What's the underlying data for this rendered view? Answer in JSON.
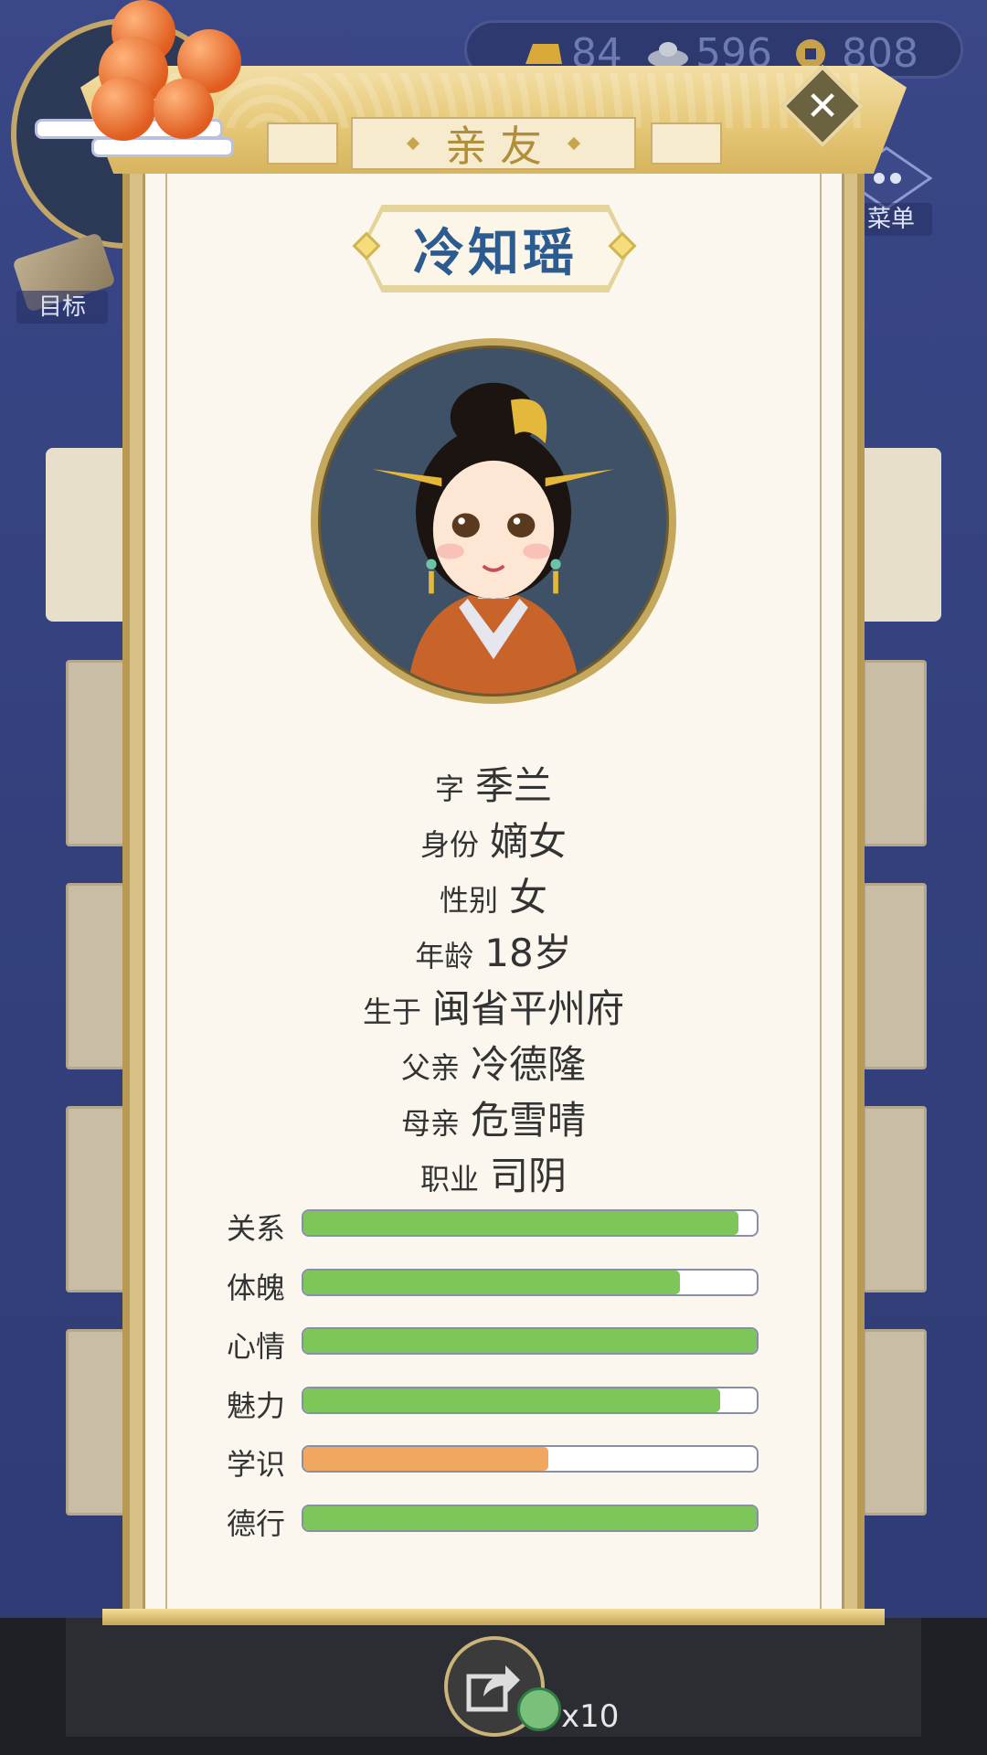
{
  "hud": {
    "goal_label": "目标",
    "menu_label": "菜单"
  },
  "currency": {
    "gold": "84",
    "silver": "596",
    "coins": "808"
  },
  "modal": {
    "title": "亲友",
    "name": "冷知瑶",
    "info": [
      {
        "label": "字",
        "value": "季兰"
      },
      {
        "label": "身份",
        "value": "嫡女"
      },
      {
        "label": "性别",
        "value": "女"
      },
      {
        "label": "年龄",
        "value": "18岁"
      },
      {
        "label": "生于",
        "value": "闽省平州府"
      },
      {
        "label": "父亲",
        "value": "冷德隆"
      },
      {
        "label": "母亲",
        "value": "危雪晴"
      },
      {
        "label": "职业",
        "value": "司阴"
      }
    ],
    "stats": [
      {
        "label": "关系",
        "value": 0.96,
        "color": "#7cc65a"
      },
      {
        "label": "体魄",
        "value": 0.83,
        "color": "#7cc65a"
      },
      {
        "label": "心情",
        "value": 1.0,
        "color": "#7cc65a"
      },
      {
        "label": "魅力",
        "value": 0.92,
        "color": "#7cc65a"
      },
      {
        "label": "学识",
        "value": 0.54,
        "color": "#f0a860"
      },
      {
        "label": "德行",
        "value": 1.0,
        "color": "#7cc65a"
      }
    ]
  },
  "bottom": {
    "share_count": "x10"
  },
  "icons": {
    "close": "close-icon",
    "share": "share-icon",
    "gold": "gold-ingot-icon",
    "silver": "silver-ingot-icon",
    "coin": "copper-coin-icon"
  }
}
